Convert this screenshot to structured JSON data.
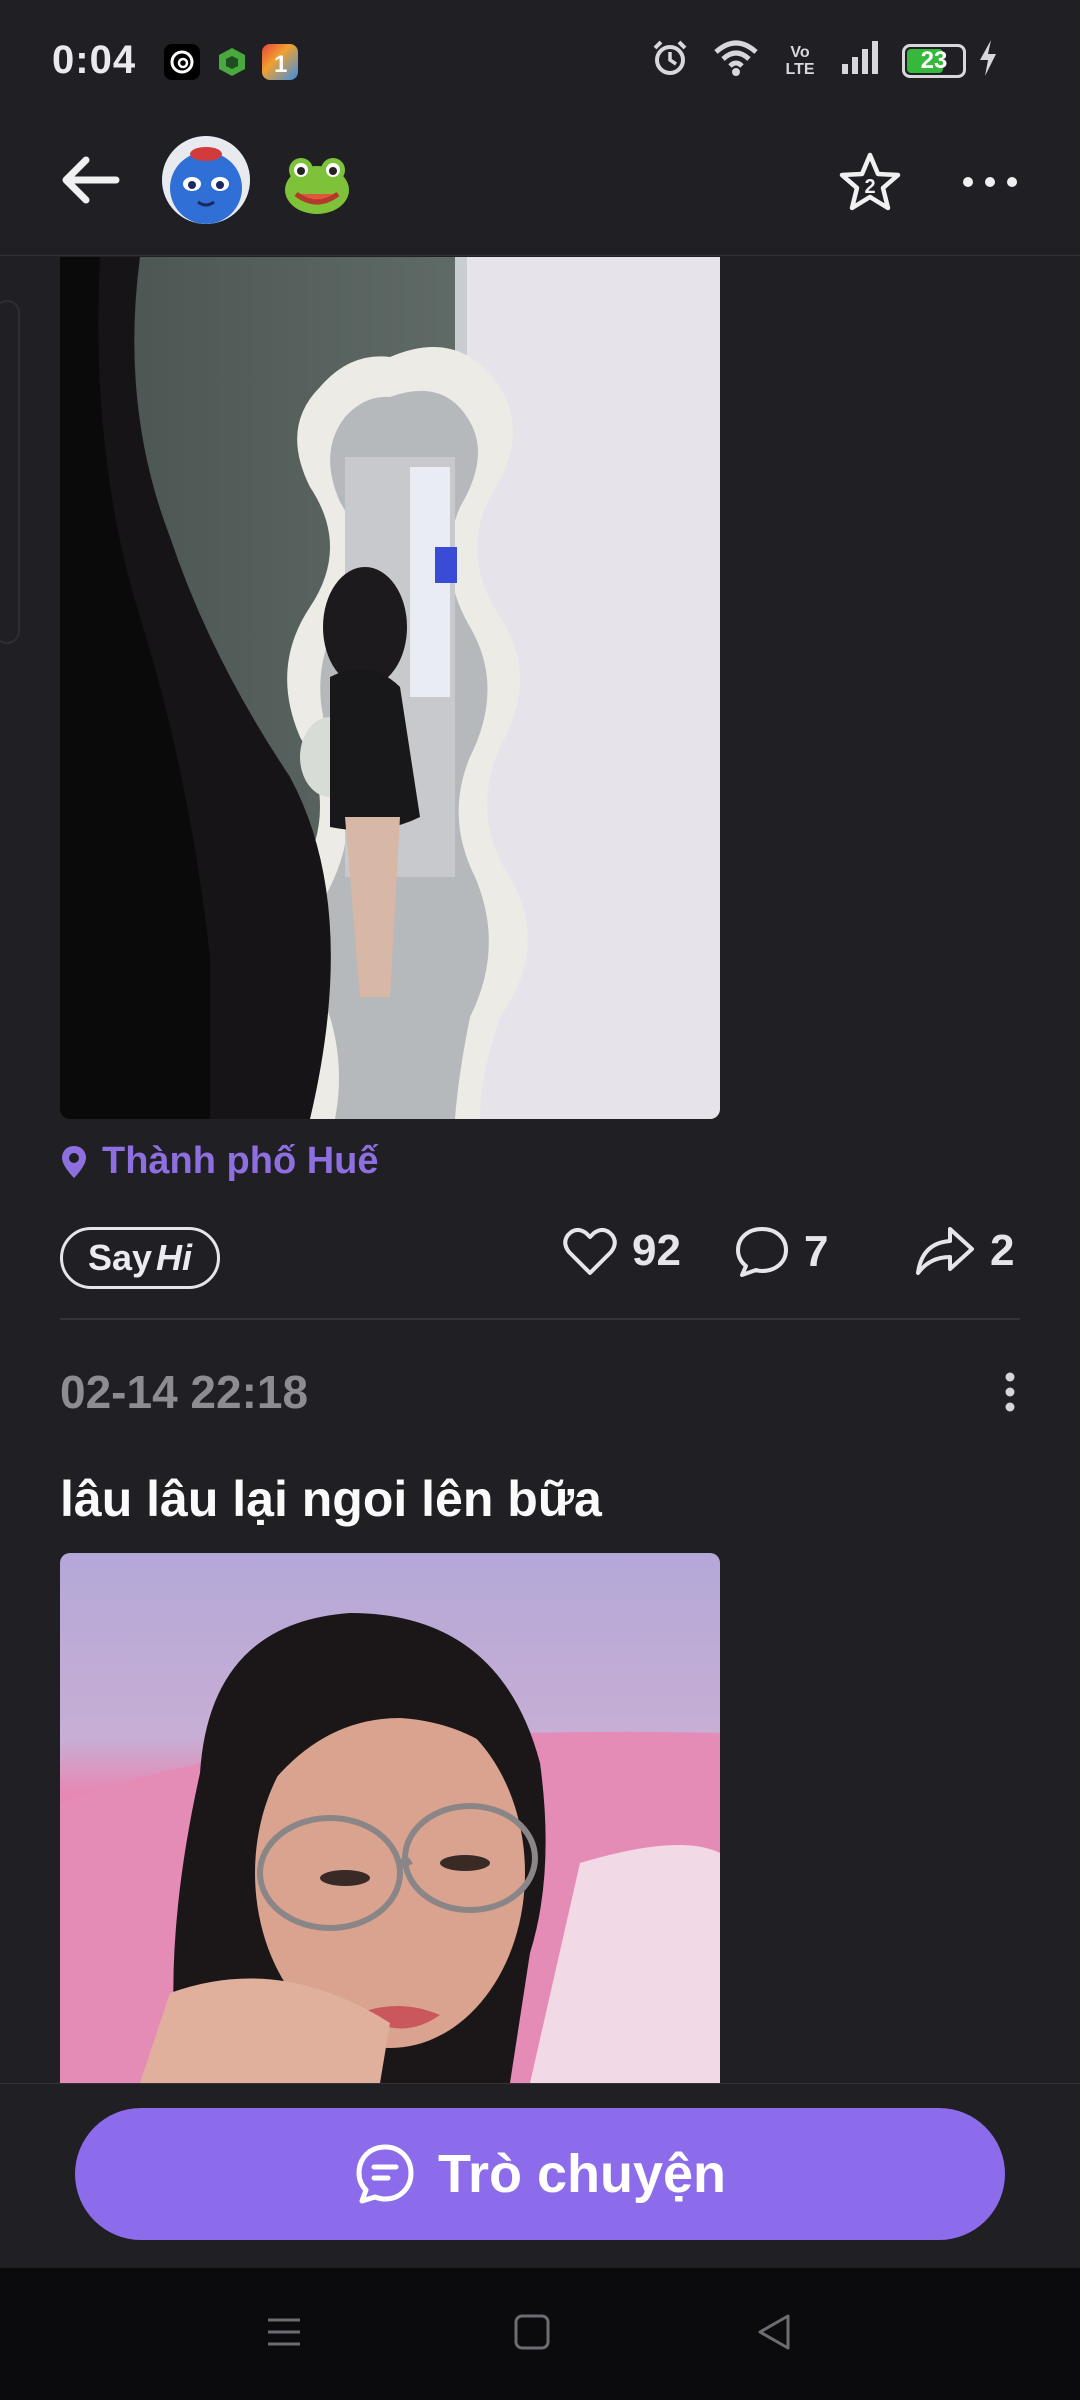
{
  "status_bar": {
    "time": "0:04",
    "battery_level": "23",
    "network": "Vo LTE",
    "icons": [
      "threads-icon",
      "app-icon",
      "app-icon",
      "alarm-icon",
      "wifi-icon",
      "volte-icon",
      "signal-icon",
      "battery-icon",
      "charging-icon"
    ]
  },
  "header": {
    "back_icon": "arrow-left-icon",
    "emoji": "🐸",
    "star_badge": "2",
    "menu_icon": "more-horizontal-icon"
  },
  "post1": {
    "location": "Thành phố Huế",
    "say_hi": {
      "say": "Say",
      "hi": "Hi"
    },
    "likes": "92",
    "comments": "7",
    "shares": "2"
  },
  "post2": {
    "timestamp": "02-14 22:18",
    "text": "lâu lâu lại ngoi lên bữa"
  },
  "chat_button": {
    "label": "Trò chuyện"
  },
  "colors": {
    "accent": "#8c6cea",
    "background": "#201f24",
    "location": "#8e6fe0"
  }
}
